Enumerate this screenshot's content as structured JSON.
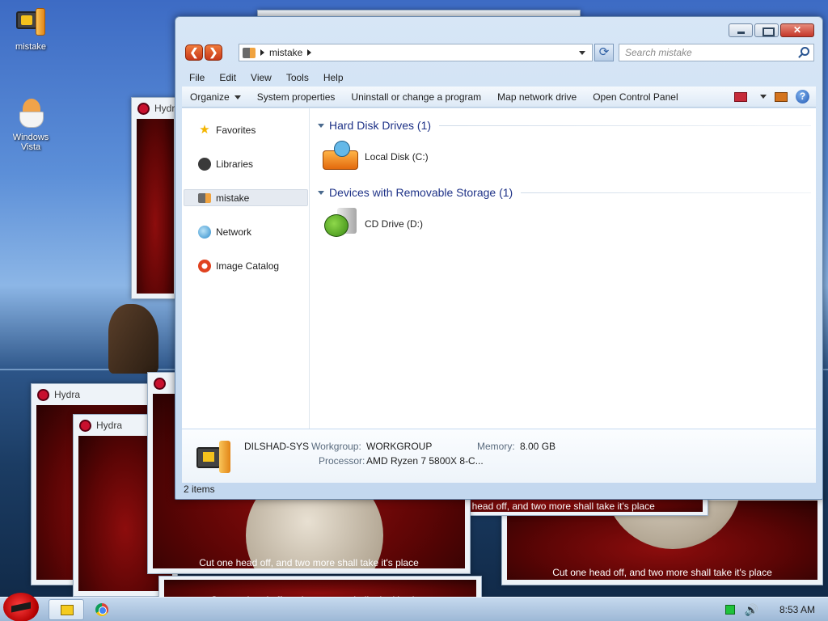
{
  "desktop": {
    "icons": [
      {
        "label": "mistake"
      },
      {
        "label": "Windows Vista"
      }
    ]
  },
  "hydra_windows": {
    "title": "Hydra",
    "caption": "Cut one head off, and two more shall take it's place"
  },
  "explorer": {
    "address": {
      "crumb": "mistake",
      "search_placeholder": "Search mistake"
    },
    "menu": [
      "File",
      "Edit",
      "View",
      "Tools",
      "Help"
    ],
    "commands": {
      "organize": "Organize",
      "system_properties": "System properties",
      "uninstall": "Uninstall or change a program",
      "map_drive": "Map network drive",
      "control_panel": "Open Control Panel"
    },
    "nav": [
      "Favorites",
      "Libraries",
      "mistake",
      "Network",
      "Image Catalog"
    ],
    "groups": [
      {
        "title": "Hard Disk Drives (1)",
        "items": [
          "Local Disk (C:)"
        ]
      },
      {
        "title": "Devices with Removable Storage (1)",
        "items": [
          "CD Drive (D:)"
        ]
      }
    ],
    "details": {
      "name": "DILSHAD-SYS",
      "workgroup_label": "Workgroup:",
      "workgroup": "WORKGROUP",
      "memory_label": "Memory:",
      "memory": "8.00 GB",
      "processor_label": "Processor:",
      "processor": "AMD Ryzen 7 5800X 8-C..."
    },
    "status": "2 items"
  },
  "taskbar": {
    "clock": "8:53 AM"
  },
  "colors": {
    "accent": "#1e3287",
    "hydra_red": "#8d0d0d",
    "nav_button": "#e0561f"
  }
}
